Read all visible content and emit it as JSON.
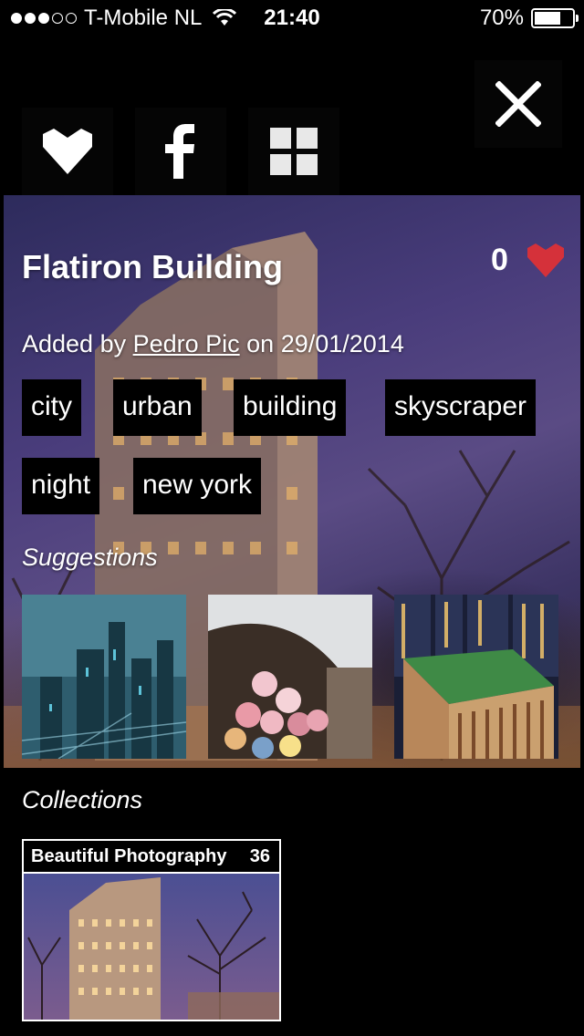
{
  "status_bar": {
    "carrier": "T-Mobile NL",
    "time": "21:40",
    "battery": "70%",
    "battery_level": 0.7
  },
  "toolbar": {
    "like_icon": "heart-icon",
    "share_icon": "facebook-icon",
    "grid_icon": "grid-icon",
    "close_icon": "close-icon"
  },
  "photo": {
    "title": "Flatiron Building",
    "likes": "0",
    "added_prefix": "Added by ",
    "author": "Pedro Pic",
    "date_prefix": " on ",
    "date": "29/01/2014",
    "tags": [
      "city",
      "urban",
      "building",
      "skyscraper",
      "night",
      "new york"
    ]
  },
  "suggestions": {
    "label": "Suggestions"
  },
  "collections": {
    "label": "Collections",
    "items": [
      {
        "name": "Beautiful Photography",
        "count": "36"
      }
    ]
  },
  "colors": {
    "heart": "#d5313a",
    "background": "#000000",
    "text": "#ffffff"
  }
}
